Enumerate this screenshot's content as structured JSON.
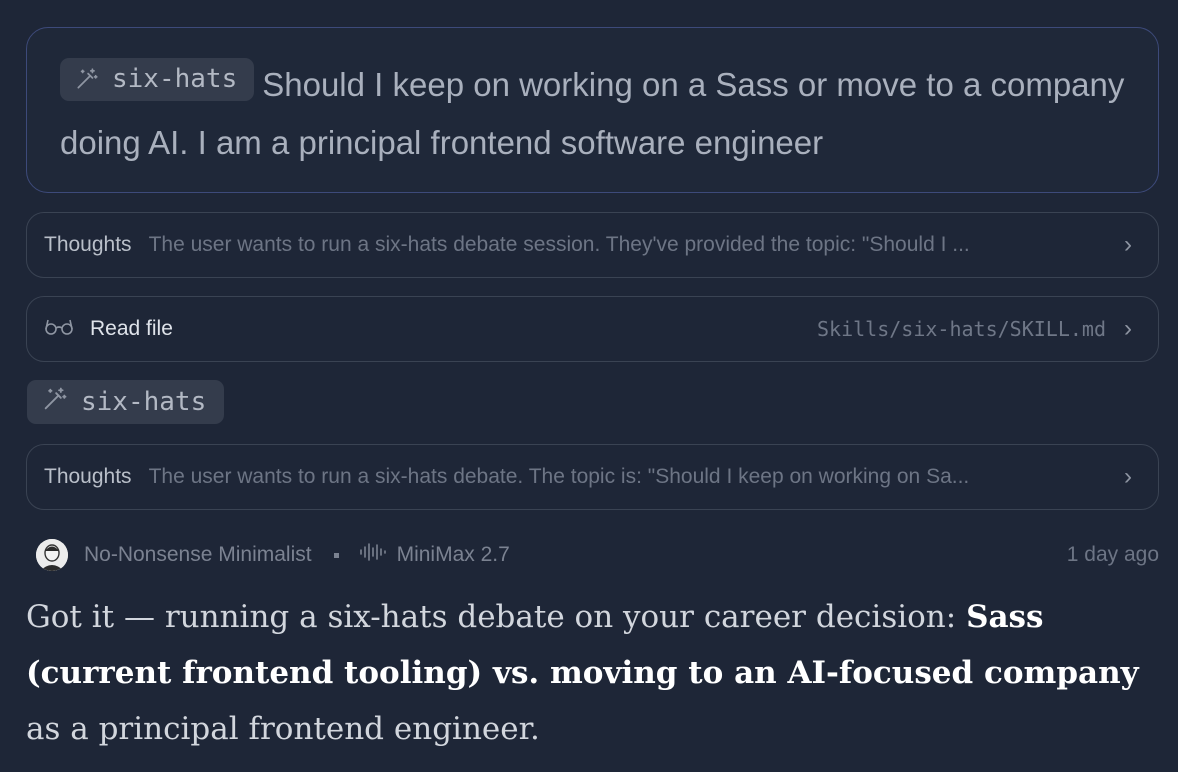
{
  "prompt": {
    "skill_chip": "six-hats",
    "text": "Should I keep on working on a Sass or move to a company doing AI. I am a principal frontend software engineer"
  },
  "thoughts1": {
    "label": "Thoughts",
    "summary": "The user wants to run a six-hats debate session. They've provided the topic: \"Should I ..."
  },
  "read_file": {
    "label": "Read file",
    "path": "Skills/six-hats/SKILL.md"
  },
  "skill_chip": "six-hats",
  "thoughts2": {
    "label": "Thoughts",
    "summary": "The user wants to run a six-hats debate. The topic is: \"Should I keep on working on Sa..."
  },
  "meta": {
    "persona": "No-Nonsense Minimalist",
    "model": "MiniMax 2.7",
    "time": "1 day ago"
  },
  "message": {
    "intro": "Got it — running a six-hats debate on your career decision: ",
    "bold": "Sass (current frontend tooling) vs. moving to an AI-focused company",
    "outro": " as a principal frontend engineer."
  },
  "icons": {
    "skill": "magic-wand-icon",
    "read": "glasses-icon",
    "model": "waveform-icon",
    "chevron": "chevron-right-icon"
  }
}
